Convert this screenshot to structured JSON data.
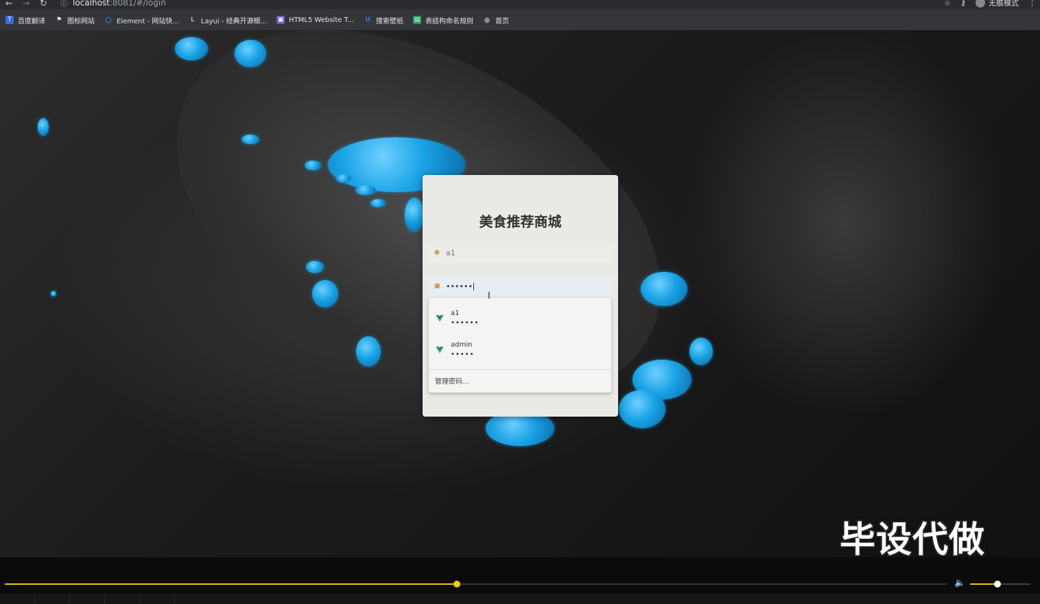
{
  "browser": {
    "url_host": "localhost",
    "url_rest": ":8081/#/login",
    "profile_label": "无痕模式",
    "icons": {
      "back": "arrow-left-icon",
      "forward": "arrow-right-icon",
      "reload": "reload-icon",
      "info": "info-icon",
      "star": "star-icon",
      "key": "key-icon",
      "menu": "kebab-menu-icon"
    }
  },
  "bookmarks": [
    {
      "label": "百度翻译",
      "icon": "baidu-translate-icon",
      "color": "#2f6ce5"
    },
    {
      "label": "图标网站",
      "icon": "flag-icon",
      "color": "#555555"
    },
    {
      "label": "Element - 网站快...",
      "icon": "element-icon",
      "color": "#409eff"
    },
    {
      "label": "Layui - 经典开源模...",
      "icon": "layui-icon",
      "color": "#555555"
    },
    {
      "label": "HTML5 Website T...",
      "icon": "html5-template-icon",
      "color": "#6a5acd"
    },
    {
      "label": "搜索壁纸",
      "icon": "wallpaper-icon",
      "color": "#3a7bd5"
    },
    {
      "label": "表结构命名规则",
      "icon": "table-icon",
      "color": "#1aa260"
    },
    {
      "label": "首页",
      "icon": "globe-icon",
      "color": "#777777"
    }
  ],
  "login": {
    "title": "美食推荐商城",
    "username_value": "a1",
    "password_value": "••••••"
  },
  "autofill": {
    "items": [
      {
        "user": "a1",
        "pw": "••••••"
      },
      {
        "user": "admin",
        "pw": "•••••"
      }
    ],
    "manage_label": "管理密码..."
  },
  "watermark": "毕设代做",
  "player": {
    "progress_fraction": 0.48,
    "volume_fraction": 0.45,
    "colors": {
      "accent": "#f2c811"
    }
  }
}
